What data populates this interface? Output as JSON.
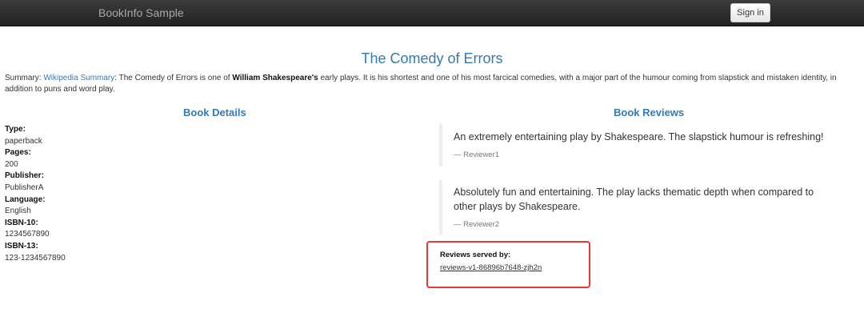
{
  "nav": {
    "brand": "BookInfo Sample",
    "sign_in": "Sign in"
  },
  "book": {
    "title": "The Comedy of Errors",
    "summary_prefix": "Summary: ",
    "summary_link": "Wikipedia Summary",
    "summary_mid": ": The Comedy of Errors is one of ",
    "summary_bold": "William Shakespeare's",
    "summary_rest": " early plays. It is his shortest and one of his most farcical comedies, with a major part of the humour coming from slapstick and mistaken identity, in addition to puns and word play."
  },
  "details": {
    "heading": "Book Details",
    "fields": [
      {
        "label": "Type:",
        "value": "paperback"
      },
      {
        "label": "Pages:",
        "value": "200"
      },
      {
        "label": "Publisher:",
        "value": "PublisherA"
      },
      {
        "label": "Language:",
        "value": "English"
      },
      {
        "label": "ISBN-10:",
        "value": "1234567890"
      },
      {
        "label": "ISBN-13:",
        "value": "123-1234567890"
      }
    ]
  },
  "reviews": {
    "heading": "Book Reviews",
    "items": [
      {
        "text": "An extremely entertaining play by Shakespeare. The slapstick humour is refreshing!",
        "reviewer": "— Reviewer1"
      },
      {
        "text": "Absolutely fun and entertaining. The play lacks thematic depth when compared to other plays by Shakespeare.",
        "reviewer": "— Reviewer2"
      }
    ],
    "served_by_label": "Reviews served by:",
    "served_by_pod": "reviews-v1-86896b7648-zjh2n"
  },
  "colors": {
    "link": "#337ab7",
    "highlight_box": "#e53935",
    "navbar": "#222222"
  }
}
